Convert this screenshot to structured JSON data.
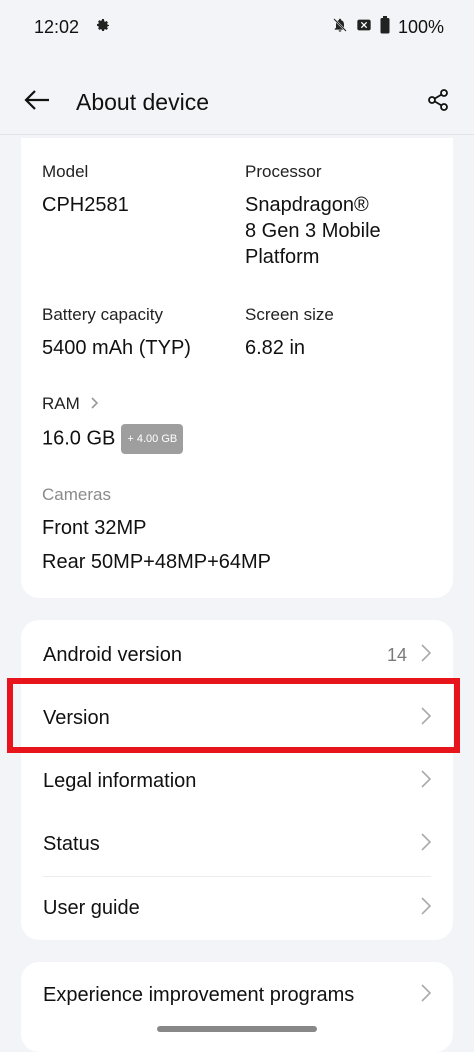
{
  "status_bar": {
    "time": "12:02",
    "battery": "100%"
  },
  "app_bar": {
    "title": "About device"
  },
  "info": {
    "model_label": "Model",
    "model_value": "CPH2581",
    "processor_label": "Processor",
    "processor_value_1": "Snapdragon®",
    "processor_value_2": "8 Gen 3 Mobile",
    "processor_value_3": "Platform",
    "battery_label": "Battery capacity",
    "battery_value": "5400 mAh (TYP)",
    "screen_label": "Screen size",
    "screen_value": "6.82 in",
    "ram_label": "RAM",
    "ram_value": "16.0 GB",
    "ram_extra": "+ 4.00 GB",
    "cameras_label": "Cameras",
    "front_label": "Front",
    "front_value": "32MP",
    "rear_label": "Rear",
    "rear_value": "50MP+48MP+64MP"
  },
  "menu": {
    "items": [
      {
        "label": "Android version",
        "value": "14"
      },
      {
        "label": "Version"
      },
      {
        "label": "Legal information"
      },
      {
        "label": "Status"
      },
      {
        "label": "User guide"
      }
    ]
  },
  "menu2": {
    "items": [
      {
        "label": "Experience improvement programs"
      }
    ]
  },
  "colors": {
    "highlight": "#e8141c",
    "background": "#f3f4f7"
  }
}
